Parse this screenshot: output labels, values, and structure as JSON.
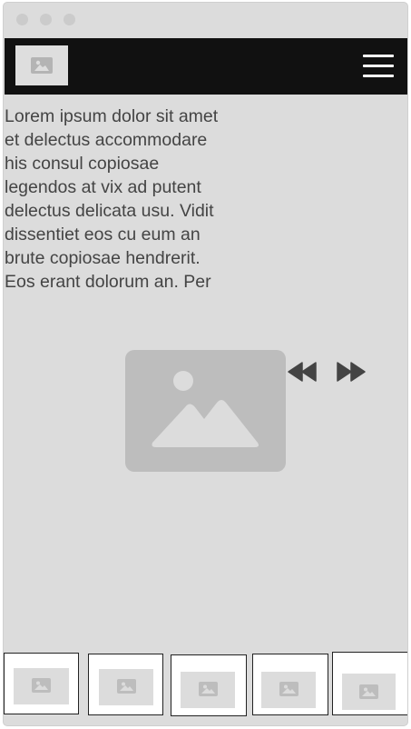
{
  "window": {
    "controls": [
      "close-dot",
      "minimize-dot",
      "maximize-dot"
    ]
  },
  "navbar": {
    "logo_icon": "image-placeholder-icon",
    "menu_icon": "hamburger-menu-icon",
    "background": "#111111"
  },
  "content": {
    "paragraph": "Lorem ipsum dolor sit amet\net delectus accommodare\nhis consul copiosae\nlegendos at vix ad putent\ndelectus delicata usu. Vidit\ndissentiet eos cu eum an\nbrute copiosae hendrerit.\nEos erant dolorum an. Per"
  },
  "carousel": {
    "hero_icon": "image-placeholder-icon",
    "prev_icon": "rewind-icon",
    "next_icon": "fast-forward-icon",
    "thumbnails": [
      {
        "icon": "image-placeholder-icon"
      },
      {
        "icon": "image-placeholder-icon"
      },
      {
        "icon": "image-placeholder-icon"
      },
      {
        "icon": "image-placeholder-icon"
      },
      {
        "icon": "image-placeholder-icon"
      }
    ]
  },
  "colors": {
    "window_bg": "#dcdcdc",
    "placeholder": "#bdbdbd",
    "text": "#444444"
  }
}
